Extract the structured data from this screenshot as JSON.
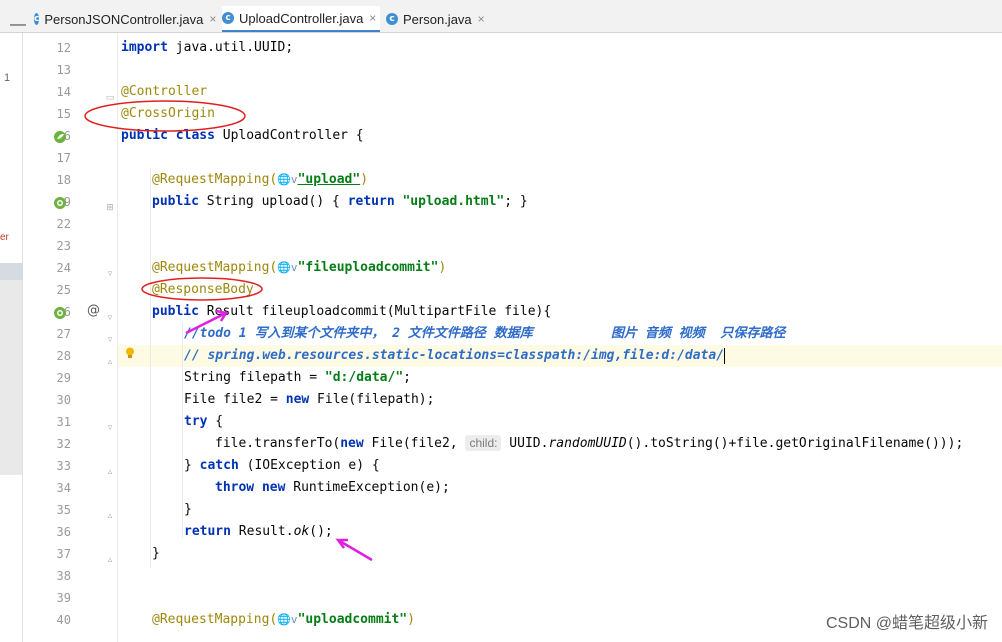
{
  "tabs": [
    {
      "name": "PersonJSONController.java",
      "active": false
    },
    {
      "name": "UploadController.java",
      "active": true
    },
    {
      "name": "Person.java",
      "active": false
    }
  ],
  "tab_close": "×",
  "tab_icon_letter": "c",
  "dash": "—",
  "left_panel": {
    "t1": "1",
    "t2": "er"
  },
  "line_numbers": [
    "12",
    "13",
    "14",
    "15",
    "16",
    "17",
    "18",
    "19",
    "22",
    "23",
    "24",
    "25",
    "26",
    "27",
    "28",
    "29",
    "30",
    "31",
    "32",
    "33",
    "34",
    "35",
    "36",
    "37",
    "38",
    "39",
    "40"
  ],
  "code": {
    "l12_kw": "import",
    "l12_rest": " java.util.UUID;",
    "l14": "@Controller",
    "l15": "@CrossOrigin",
    "l16_kw": "public class",
    "l16_rest": " UploadController {",
    "l18_ann": "@RequestMapping(",
    "l18_icon": "🌐v",
    "l18_str": "\"upload\"",
    "l18_end": ")",
    "l19_kw1": "public",
    "l19_mid": " String upload() { ",
    "l19_kw2": "return",
    "l19_str": " \"upload.html\"",
    "l19_end": "; }",
    "l24_ann": "@RequestMapping(",
    "l24_icon": "🌐v",
    "l24_str": "\"fileuploadcommit\"",
    "l24_end": ")",
    "l25": "@ResponseBody",
    "l26_kw": "public",
    "l26_rest": " Result fileuploadcommit(MultipartFile file){",
    "l27": "//todo 1 写入到某个文件夹中， 2 文件文件路径 数据库          图片 音频 视频  只保存路径",
    "l28": "// spring.web.resources.static-locations=classpath:/img,file:d:/data/",
    "l29_a": "String filepath = ",
    "l29_str": "\"d:/data/\"",
    "l29_b": ";",
    "l30_a": "File file2 = ",
    "l30_kw": "new",
    "l30_b": " File(filepath);",
    "l31_kw": "try",
    "l31_b": " {",
    "l32_a": "file.transferTo(",
    "l32_kw": "new",
    "l32_b": " File(file2, ",
    "l32_hint": "child:",
    "l32_c": " UUID.",
    "l32_it": "randomUUID",
    "l32_d": "().toString()+file.getOriginalFilename()));",
    "l33_a": "} ",
    "l33_kw": "catch",
    "l33_b": " (IOException e) {",
    "l34_kw": "throw new",
    "l34_b": " RuntimeException(e);",
    "l35": "}",
    "l36_kw": "return",
    "l36_a": " Result.",
    "l36_it": "ok",
    "l36_b": "();",
    "l37": "}",
    "l40_ann": "@RequestMapping(",
    "l40_icon": "🌐v",
    "l40_str": "\"uploadcommit\"",
    "l40_end": ")"
  },
  "gutter_at": "@",
  "watermark": "CSDN @蜡笔超级小新",
  "colors": {
    "keyword": "#0033b3",
    "annotation": "#9e880d",
    "string": "#067d17",
    "comment": "#8c8c8c",
    "markup": "#e02020",
    "arrow": "#e020e0"
  }
}
